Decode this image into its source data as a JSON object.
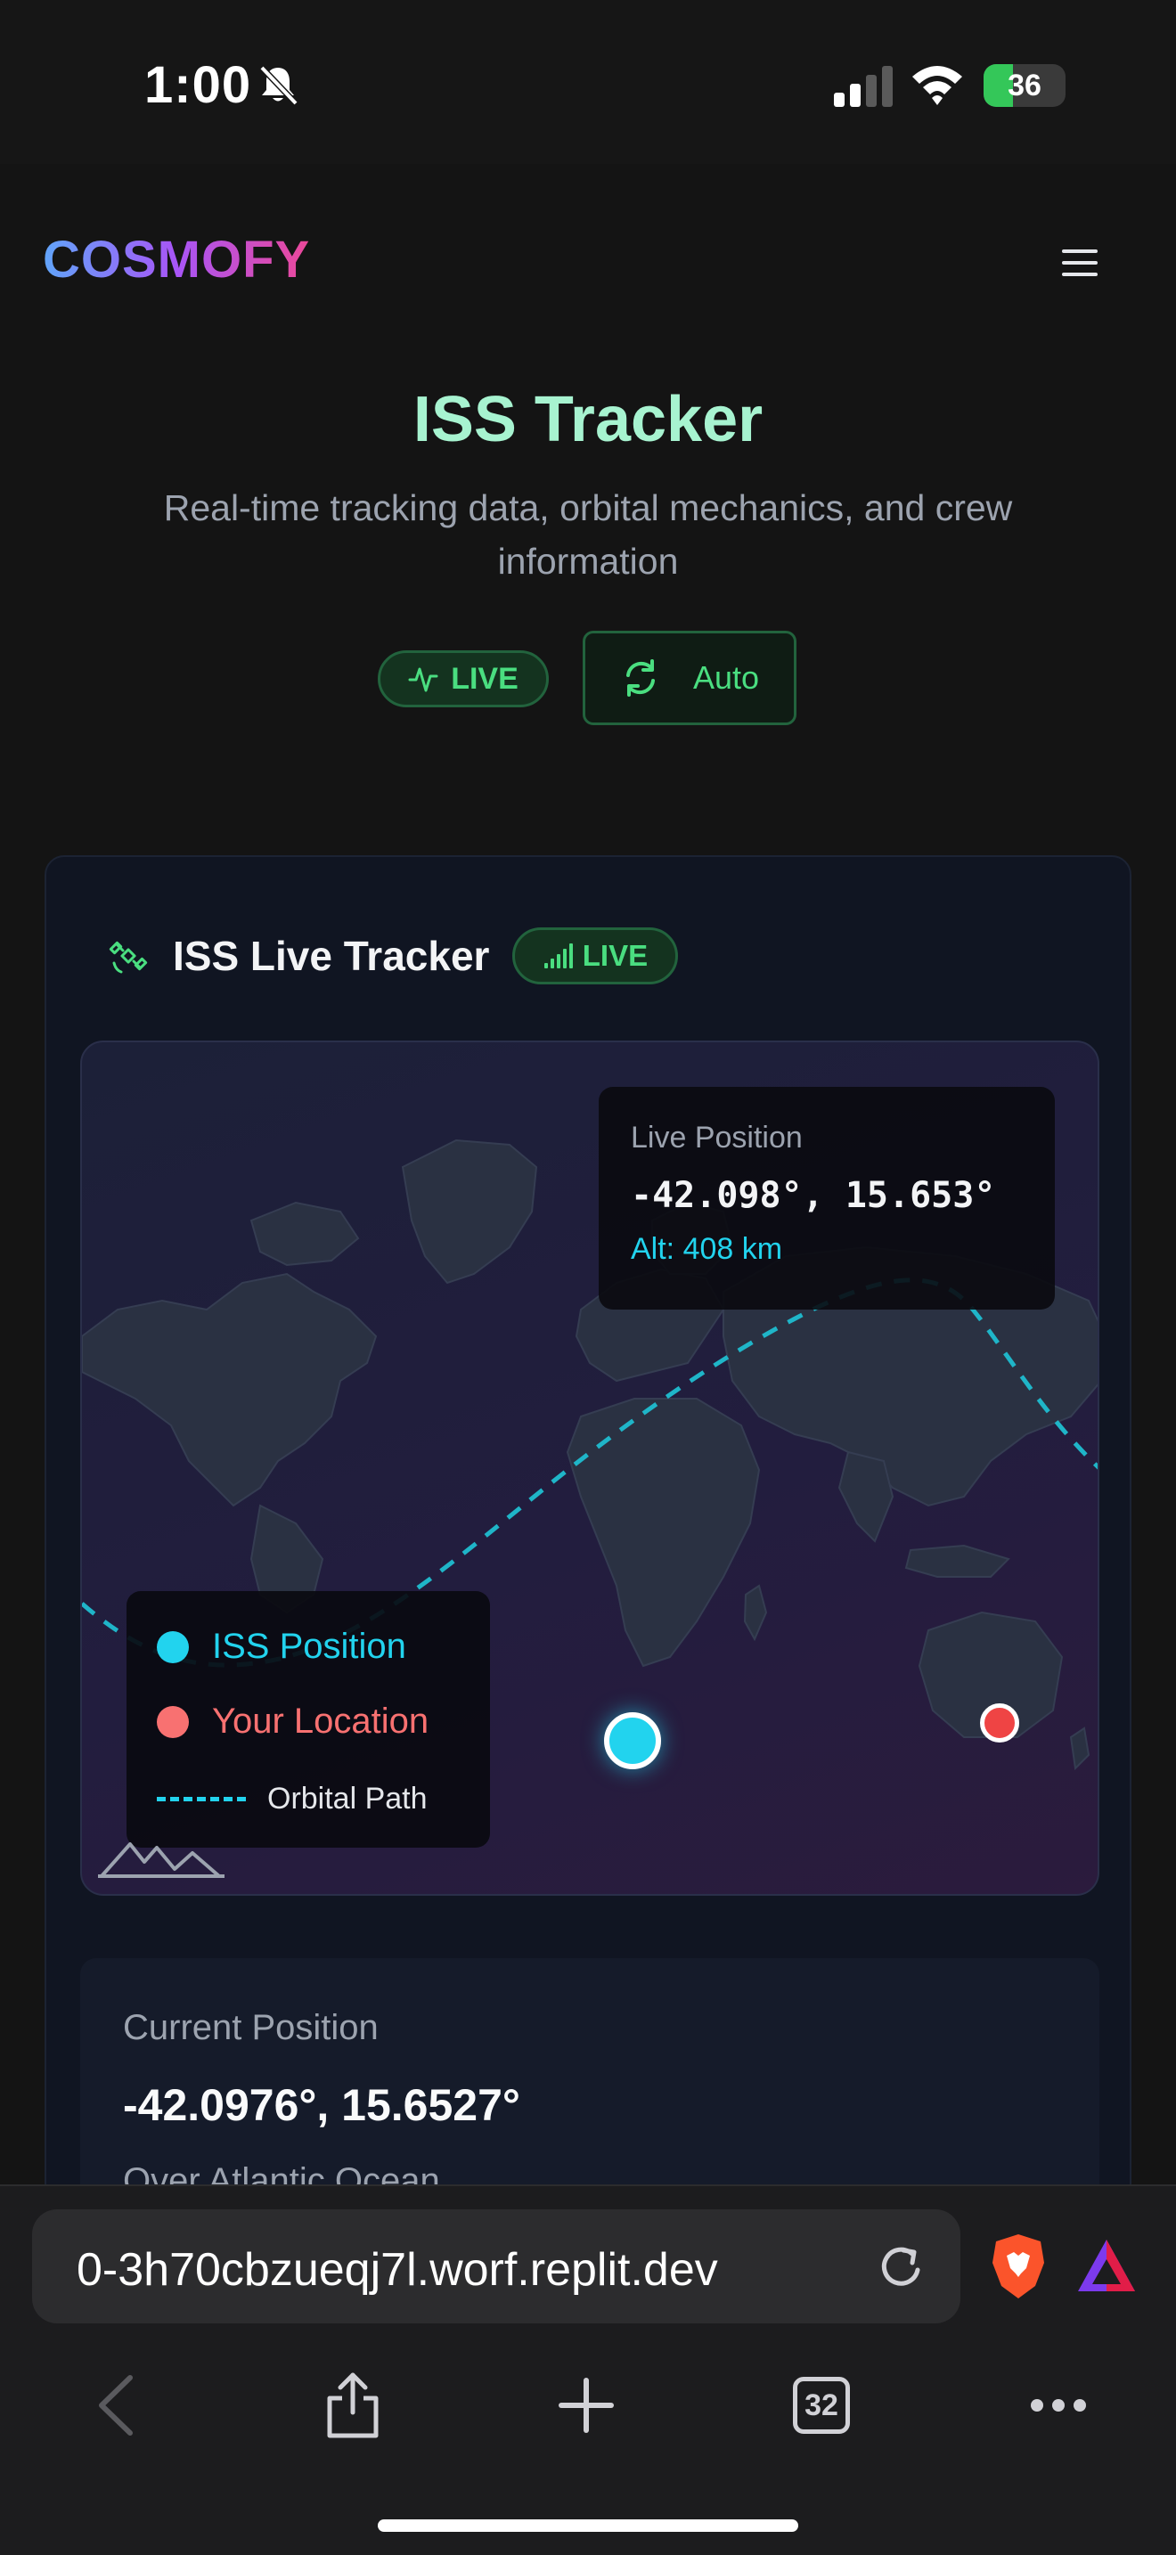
{
  "status_bar": {
    "time": "1:00",
    "battery": "36",
    "battery_level": 0.36
  },
  "header": {
    "logo": "COSMOFY",
    "menu_icon": "hamburger-menu-icon"
  },
  "hero": {
    "title": "ISS Tracker",
    "subtitle": "Real-time tracking data, orbital mechanics, and crew information",
    "live_badge": "LIVE",
    "auto_button": "Auto"
  },
  "tracker": {
    "title": "ISS Live Tracker",
    "live_badge": "LIVE",
    "live_position": {
      "label": "Live Position",
      "coords": "-42.098°, 15.653°",
      "altitude": "Alt: 408 km"
    },
    "legend": {
      "iss": "ISS Position",
      "you": "Your Location",
      "path": "Orbital Path"
    },
    "current_position": {
      "label": "Current Position",
      "coords": "-42.0976°, 15.6527°",
      "location": "Over Atlantic Ocean"
    }
  },
  "browser": {
    "url": "0-3h70cbzueqj7l.worf.replit.dev",
    "tabs_count": "32"
  },
  "colors": {
    "accent_green": "#4ade80",
    "iss_cyan": "#22d3ee",
    "user_red": "#ef4444",
    "title_mint": "#a7f3d0"
  }
}
